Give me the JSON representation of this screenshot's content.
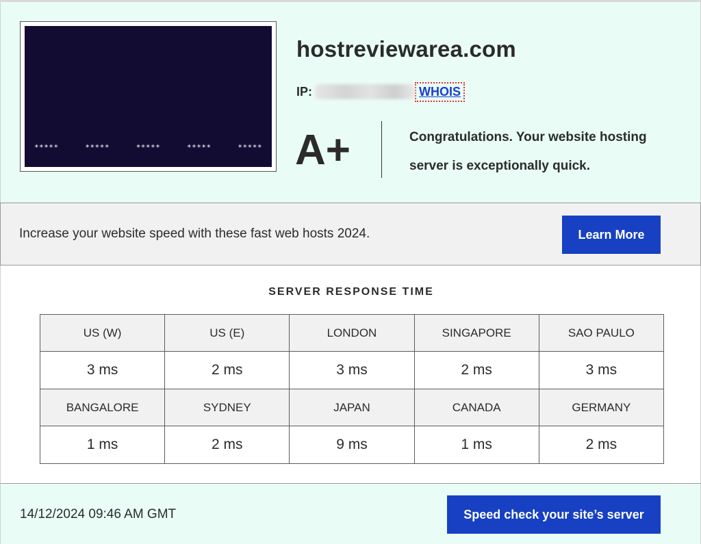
{
  "site": {
    "domain": "hostreviewarea.com",
    "ip_label": "IP:",
    "whois_link": "WHOIS",
    "grade": "A+",
    "message": "Congratulations. Your website hosting server is exceptionally quick.",
    "thumbnail_stars": [
      "*****",
      "*****",
      "*****",
      "*****",
      "*****"
    ]
  },
  "promo": {
    "text": "Increase your website speed with these fast web hosts 2024.",
    "button_label": "Learn More"
  },
  "response_time": {
    "title": "SERVER RESPONSE TIME",
    "rows": [
      {
        "locations": [
          "US (W)",
          "US (E)",
          "LONDON",
          "SINGAPORE",
          "SAO PAULO"
        ],
        "values": [
          "3 ms",
          "2 ms",
          "3 ms",
          "2 ms",
          "3 ms"
        ]
      },
      {
        "locations": [
          "BANGALORE",
          "SYDNEY",
          "JAPAN",
          "CANADA",
          "GERMANY"
        ],
        "values": [
          "1 ms",
          "2 ms",
          "9 ms",
          "1 ms",
          "2 ms"
        ]
      }
    ]
  },
  "footer": {
    "timestamp": "14/12/2024 09:46 AM GMT",
    "button_label": "Speed check your site’s server"
  },
  "colors": {
    "panel_bg": "#e9fdf6",
    "accent_button": "#1740c3",
    "link": "#1a3fd0",
    "thumbnail_bg": "#120c33"
  }
}
